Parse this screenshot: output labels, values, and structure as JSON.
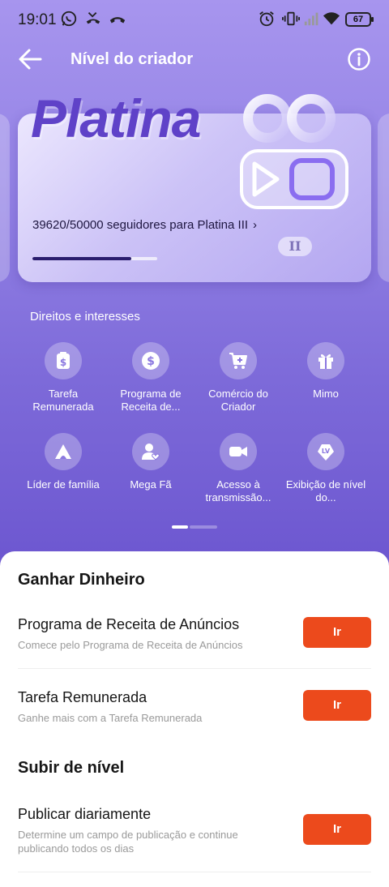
{
  "status_bar": {
    "time": "19:01",
    "battery": "67",
    "icons": [
      "whatsapp-icon",
      "missed-call-icon",
      "call-end-icon",
      "alarm-icon",
      "vibrate-icon",
      "signal-icon",
      "wifi-icon",
      "battery-icon"
    ]
  },
  "header": {
    "title": "Nível do criador",
    "back_icon": "arrow-left-icon",
    "info_icon": "info-icon"
  },
  "level_card": {
    "level_name": "Platina",
    "progress_text": "39620/50000 seguidores para Platina III",
    "chevron": "›",
    "progress_fraction": 0.79,
    "badge": "II"
  },
  "rights": {
    "title": "Direitos e interesses",
    "items": [
      {
        "label": "Tarefa Remunerada",
        "icon": "paid-task-icon"
      },
      {
        "label": "Programa de Receita de...",
        "icon": "dollar-coin-icon"
      },
      {
        "label": "Comércio do Criador",
        "icon": "cart-icon"
      },
      {
        "label": "Mimo",
        "icon": "gift-icon"
      },
      {
        "label": "Líder de família",
        "icon": "family-tent-icon"
      },
      {
        "label": "Mega Fã",
        "icon": "fan-icon"
      },
      {
        "label": "Acesso à transmissão...",
        "icon": "video-camera-icon"
      },
      {
        "label": "Exibição de nível do...",
        "icon": "level-badge-icon"
      }
    ]
  },
  "sheet": {
    "earn_title": "Ganhar Dinheiro",
    "level_up_title": "Subir de nível",
    "tasks": [
      {
        "title": "Programa de Receita de Anúncios",
        "desc": "Comece pelo Programa de Receita de Anúncios",
        "button": "Ir"
      },
      {
        "title": "Tarefa Remunerada",
        "desc": "Ganhe mais com a Tarefa Remunerada",
        "button": "Ir"
      },
      {
        "title": "Publicar diariamente",
        "desc": "Determine um campo de publicação e continue publicando todos os dias",
        "button": "Ir"
      }
    ]
  },
  "colors": {
    "accent_button": "#ec4a1c",
    "level_text": "#5f42c8",
    "background_top": "#a795ee",
    "background_bottom": "#6b55cf"
  }
}
